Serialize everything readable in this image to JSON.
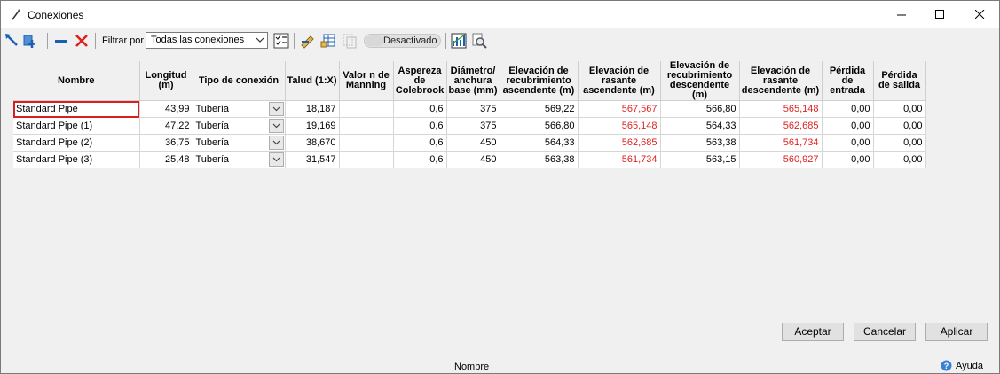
{
  "window": {
    "title": "Conexiones"
  },
  "toolbar": {
    "filter_label": "Filtrar por",
    "filter_value": "Todas las conexiones",
    "toggle_label": "Desactivado"
  },
  "grid": {
    "headers": [
      "Nombre",
      "Longitud (m)",
      "Tipo de conexión",
      "Talud (1:X)",
      "Valor n de Manning",
      "Aspereza de Colebrook",
      "Diámetro/ anchura base (mm)",
      "Elevación de recubrimiento ascendente (m)",
      "Elevación de rasante ascendente (m)",
      "Elevación de recubrimiento descendente (m)",
      "Elevación de rasante descendente (m)",
      "Pérdida de entrada",
      "Pérdida de salida"
    ],
    "rows": [
      {
        "name": "Standard Pipe",
        "length": "43,99",
        "type": "Tubería",
        "slope": "18,187",
        "manning": "",
        "colebrook": "0,6",
        "diameter": "375",
        "cover_up": "569,22",
        "invert_up": "567,567",
        "cover_down": "566,80",
        "invert_down": "565,148",
        "loss_in": "0,00",
        "loss_out": "0,00"
      },
      {
        "name": "Standard Pipe (1)",
        "length": "47,22",
        "type": "Tubería",
        "slope": "19,169",
        "manning": "",
        "colebrook": "0,6",
        "diameter": "375",
        "cover_up": "566,80",
        "invert_up": "565,148",
        "cover_down": "564,33",
        "invert_down": "562,685",
        "loss_in": "0,00",
        "loss_out": "0,00"
      },
      {
        "name": "Standard Pipe (2)",
        "length": "36,75",
        "type": "Tubería",
        "slope": "38,670",
        "manning": "",
        "colebrook": "0,6",
        "diameter": "450",
        "cover_up": "564,33",
        "invert_up": "562,685",
        "cover_down": "563,38",
        "invert_down": "561,734",
        "loss_in": "0,00",
        "loss_out": "0,00"
      },
      {
        "name": "Standard Pipe (3)",
        "length": "25,48",
        "type": "Tubería",
        "slope": "31,547",
        "manning": "",
        "colebrook": "0,6",
        "diameter": "450",
        "cover_up": "563,38",
        "invert_up": "561,734",
        "cover_down": "563,15",
        "invert_down": "560,927",
        "loss_in": "0,00",
        "loss_out": "0,00"
      }
    ]
  },
  "buttons": {
    "accept": "Aceptar",
    "cancel": "Cancelar",
    "apply": "Aplicar"
  },
  "status": {
    "text": "Nombre",
    "help": "Ayuda"
  },
  "colors": {
    "invert_value": "#e02020",
    "selection_border": "#d82020"
  }
}
